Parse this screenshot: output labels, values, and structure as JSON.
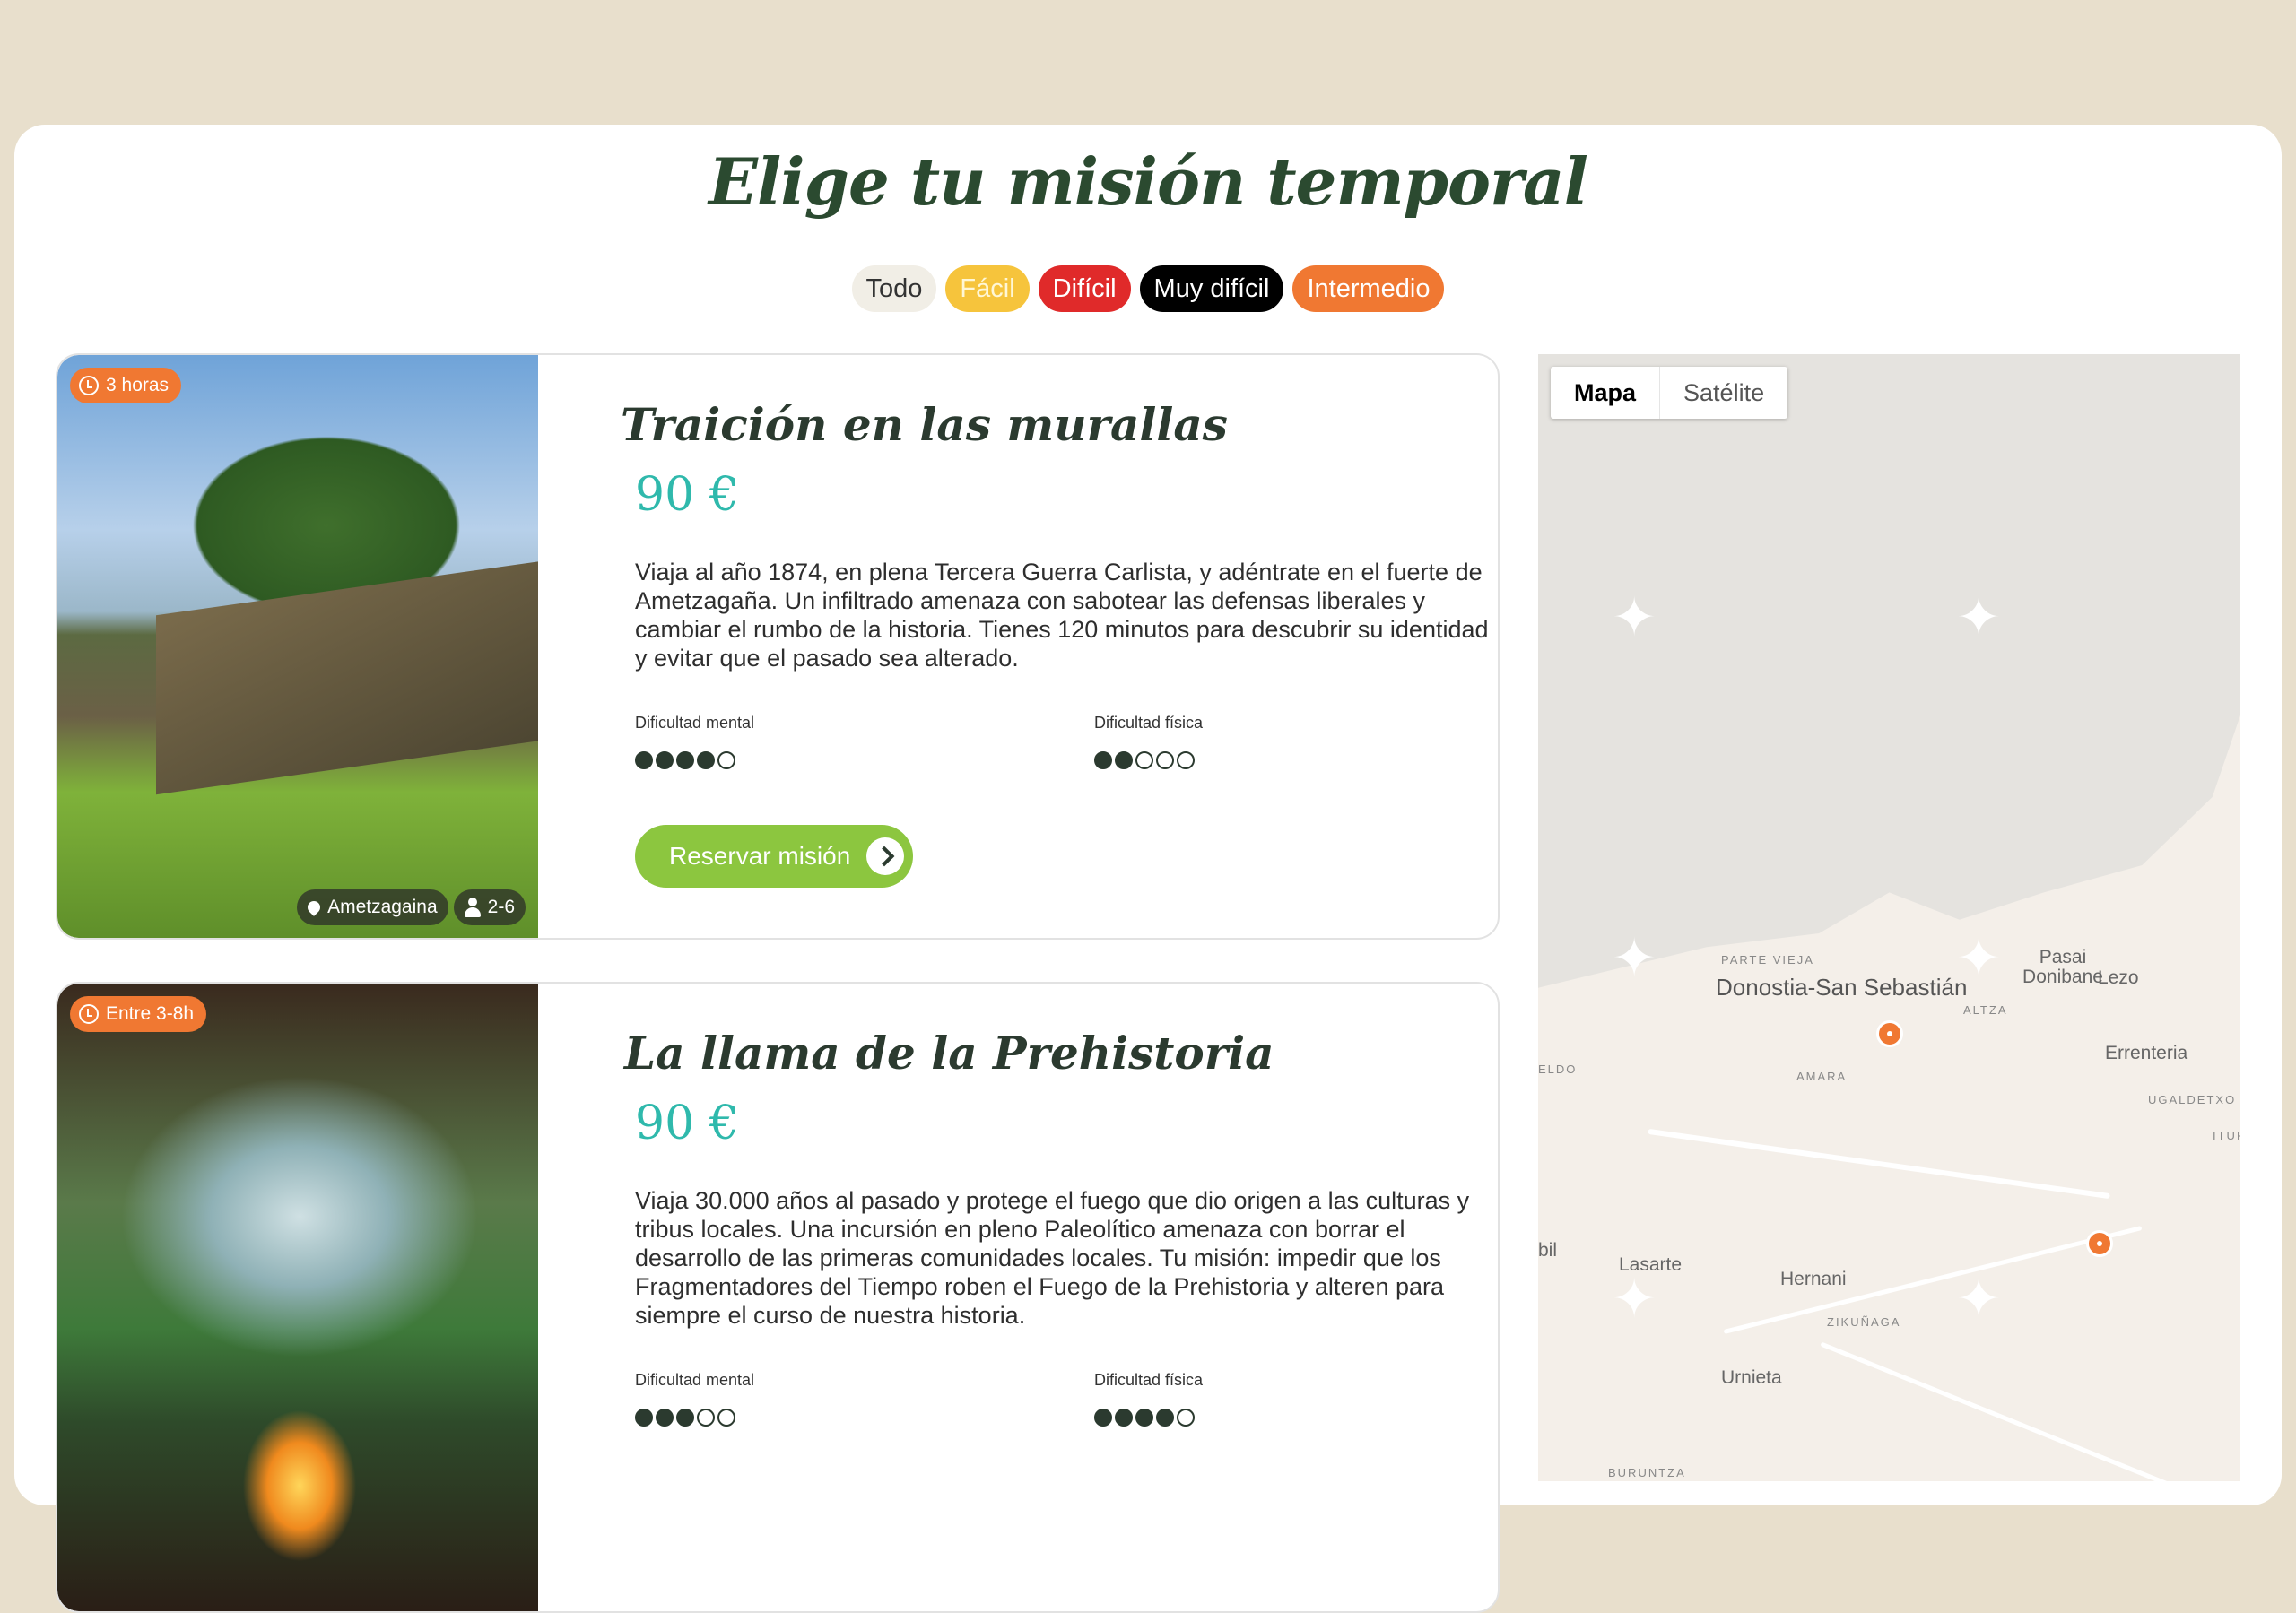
{
  "header": {
    "title": "Elige tu misión temporal"
  },
  "filters": [
    "Todo",
    "Fácil",
    "Difícil",
    "Muy difícil",
    "Intermedio"
  ],
  "missions": [
    {
      "duration": "3 horas",
      "title": "Traición en las murallas",
      "price": "90 €",
      "description": "Viaja al año 1874, en plena Tercera Guerra Carlista, y adéntrate en el fuerte de Ametzagaña. Un infiltrado amenaza con sabotear las defensas liberales y cambiar el rumbo de la historia. Tienes 120 minutos para descubrir su identidad y evitar que el pasado sea alterado.",
      "mental_label": "Dificultad mental",
      "mental_level": 4,
      "physical_label": "Dificultad física",
      "physical_level": 2,
      "location": "Ametzagaina",
      "players": "2-6",
      "cta": "Reservar misión"
    },
    {
      "duration": "Entre 3-8h",
      "title": "La llama de la Prehistoria",
      "price": "90 €",
      "description": "Viaja 30.000 años al pasado y protege el fuego que dio origen a las culturas y tribus locales. Una incursión en pleno Paleolítico amenaza con borrar el desarrollo de las primeras comunidades locales. Tu misión: impedir que los Fragmentadores del Tiempo roben el Fuego de la Prehistoria y alteren para siempre el curso de nuestra historia.",
      "mental_label": "Dificultad mental",
      "mental_level": 3,
      "physical_label": "Dificultad física",
      "physical_level": 4
    }
  ],
  "map": {
    "tabs": [
      "Mapa",
      "Satélite"
    ],
    "places": {
      "parte_vieja": "PARTE VIEJA",
      "donostia": "Donostia-San Sebastián",
      "pasai": "Pasai Donibane",
      "lezo": "Lezo",
      "altza": "ALTZA",
      "amara": "AMARA",
      "errenteria": "Errenteria",
      "ugaldetxo": "UGALDETXO",
      "itur": "ITUR",
      "eldo": "ELDO",
      "bil": "bil",
      "lasarte": "Lasarte",
      "hernani": "Hernani",
      "zikunaga": "ZIKUÑAGA",
      "urnieta": "Urnieta",
      "buruntza": "BURUNTZA"
    }
  },
  "colors": {
    "background": "#e8dfcc",
    "accent_orange": "#f07832",
    "accent_green": "#8cc63f",
    "price_teal": "#2fb9ac",
    "title_green": "#2b4a30"
  }
}
